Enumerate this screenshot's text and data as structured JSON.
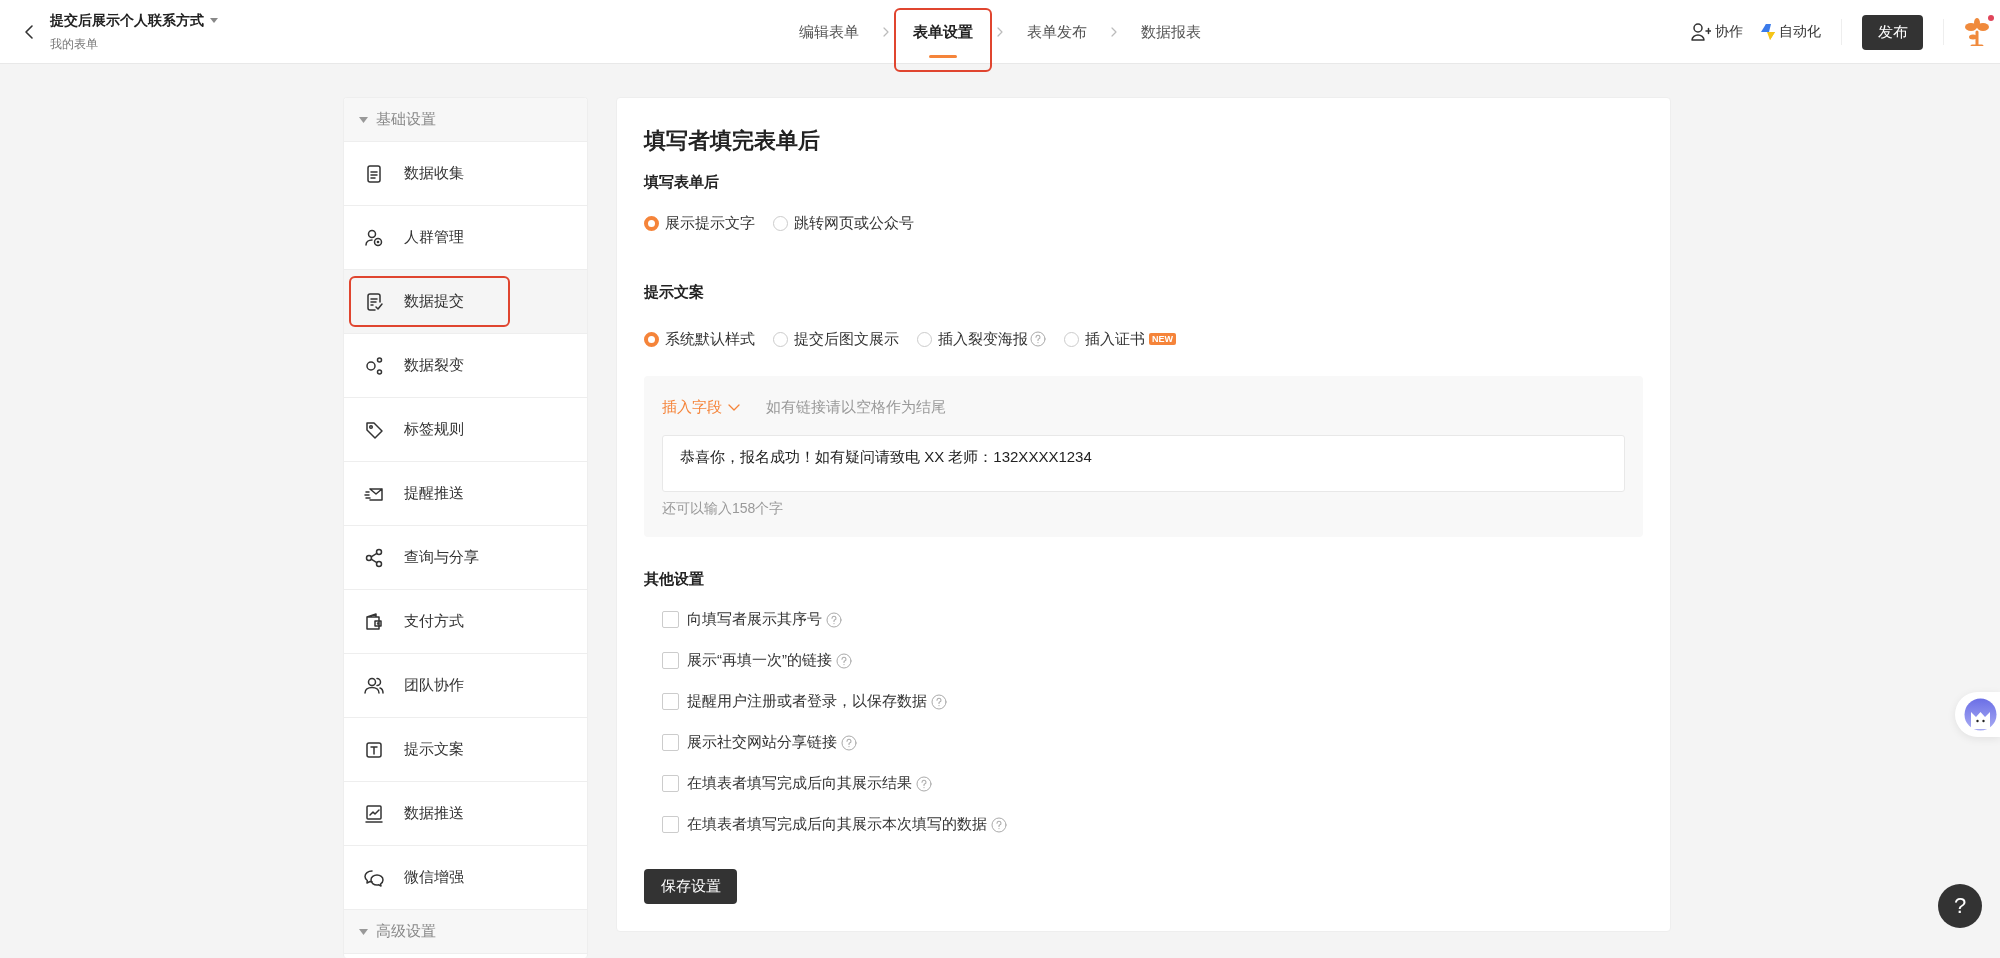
{
  "header": {
    "title": "提交后展示个人联系方式",
    "subtitle": "我的表单",
    "steps": [
      {
        "label": "编辑表单",
        "selected": false,
        "highlighted": false
      },
      {
        "label": "表单设置",
        "selected": true,
        "highlighted": true
      },
      {
        "label": "表单发布",
        "selected": false,
        "highlighted": false
      },
      {
        "label": "数据报表",
        "selected": false,
        "highlighted": false
      }
    ],
    "actions": [
      {
        "label": "协作"
      },
      {
        "label": "自动化"
      }
    ],
    "publish_button": "发布",
    "notification": true
  },
  "sidebar": {
    "sections": [
      {
        "title": "基础设置",
        "expanded": true,
        "items": [
          {
            "label": "数据收集",
            "selected": false,
            "highlighted": false
          },
          {
            "label": "人群管理",
            "selected": false,
            "highlighted": false
          },
          {
            "label": "数据提交",
            "selected": true,
            "highlighted": true
          },
          {
            "label": "数据裂变",
            "selected": false,
            "highlighted": false
          },
          {
            "label": "标签规则",
            "selected": false,
            "highlighted": false
          },
          {
            "label": "提醒推送",
            "selected": false,
            "highlighted": false
          },
          {
            "label": "查询与分享",
            "selected": false,
            "highlighted": false
          },
          {
            "label": "支付方式",
            "selected": false,
            "highlighted": false
          },
          {
            "label": "团队协作",
            "selected": false,
            "highlighted": false
          },
          {
            "label": "提示文案",
            "selected": false,
            "highlighted": false
          },
          {
            "label": "数据推送",
            "selected": false,
            "highlighted": false
          },
          {
            "label": "微信增强",
            "selected": false,
            "highlighted": false
          }
        ]
      },
      {
        "title": "高级设置",
        "expanded": true
      }
    ]
  },
  "content": {
    "title": "填写者填完表单后",
    "after_submit": {
      "label": "填写表单后",
      "options": [
        {
          "label": "展示提示文字",
          "selected": true,
          "help": false
        },
        {
          "label": "跳转网页或公众号",
          "selected": false,
          "help": false
        }
      ]
    },
    "prompt": {
      "label": "提示文案",
      "options": [
        {
          "label": "系统默认样式",
          "selected": true,
          "help": false
        },
        {
          "label": "提交后图文展示",
          "selected": false,
          "help": false
        },
        {
          "label": "插入裂变海报",
          "selected": false,
          "help": true
        },
        {
          "label": "插入证书",
          "selected": false,
          "help": false,
          "badge": "NEW"
        }
      ],
      "insert_field": "插入字段",
      "hint": "如有链接请以空格作为结尾",
      "value": "恭喜你，报名成功！如有疑问请致电 XX 老师：132XXXX1234",
      "counter": "还可以输入158个字"
    },
    "other": {
      "label": "其他设置",
      "options": [
        {
          "label": "向填写者展示其序号",
          "checked": false,
          "help": true
        },
        {
          "label": "展示“再填一次”的链接",
          "checked": false,
          "help": true
        },
        {
          "label": "提醒用户注册或者登录，以保存数据",
          "checked": false,
          "help": true
        },
        {
          "label": "展示社交网站分享链接",
          "checked": false,
          "help": true
        },
        {
          "label": "在填表者填写完成后向其展示结果",
          "checked": false,
          "help": true
        },
        {
          "label": "在填表者填写完成后向其展示本次填写的数据",
          "checked": false,
          "help": true
        }
      ]
    },
    "save_button": "保存设置"
  },
  "help_button": "?"
}
